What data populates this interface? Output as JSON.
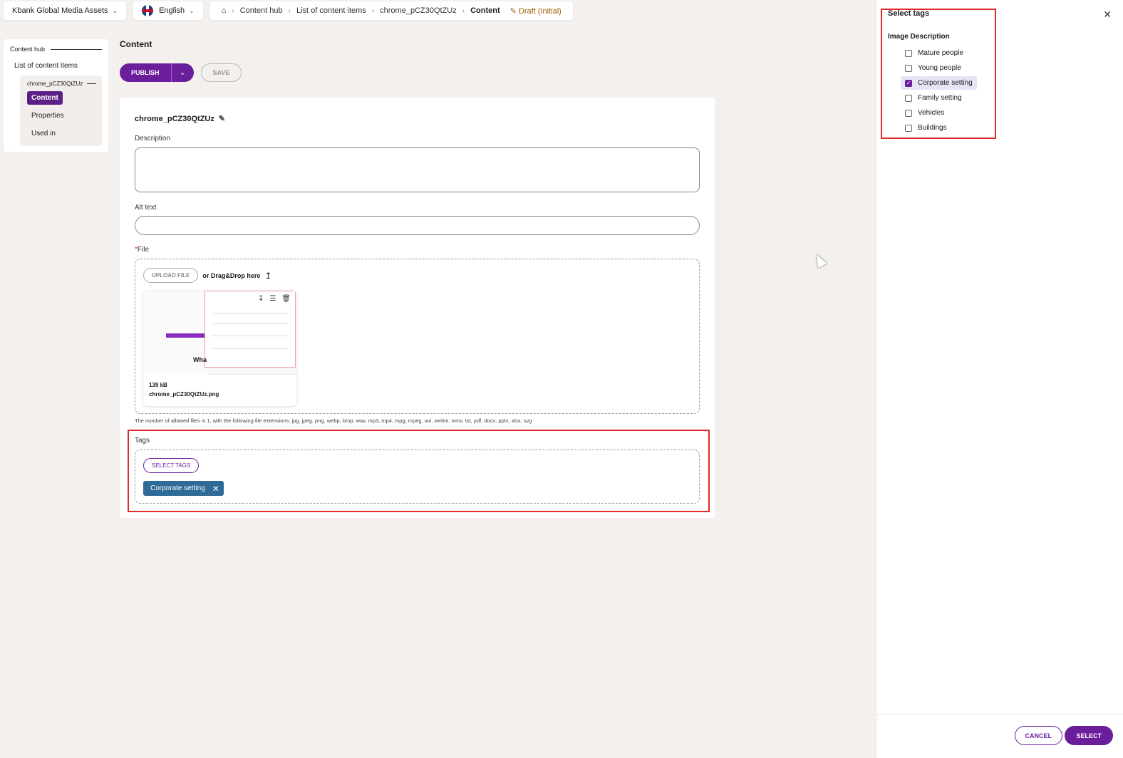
{
  "topbar": {
    "workspace": "Kbank Global Media Assets",
    "language": "English",
    "breadcrumb": [
      "Content hub",
      "List of content items",
      "chrome_pCZ30QtZUz",
      "Content"
    ],
    "status": "Draft (Initial)"
  },
  "leftnav": {
    "hub": "Content hub",
    "list": "List of content items",
    "item": "chrome_pCZ30QtZUz",
    "links": [
      "Content",
      "Properties",
      "Used in"
    ]
  },
  "main": {
    "title": "Content",
    "publish_label": "PUBLISH",
    "save_label": "SAVE",
    "item_name": "chrome_pCZ30QtZUz",
    "description_label": "Description",
    "description_value": "",
    "alt_label": "Alt text",
    "alt_value": "",
    "file_required": "*",
    "file_label": "File",
    "upload_label": "UPLOAD FILE",
    "drag_text": "or Drag&Drop here",
    "file_size": "139 kB",
    "file_name": "chrome_pCZ30QtZUz.png",
    "allowed_text": "The number of allowed files is 1, with the following file extensions: jpg, jpeg, png, webp, bmp, wav, mp3, mp4, mpg, mpeg, avi, webm, wmv, txt, pdf, docx, pptx, xlsx, svg",
    "tags_label": "Tags",
    "select_tags_label": "SELECT TAGS",
    "selected_tag": "Corporate setting",
    "thumb_heading": "Wha"
  },
  "panel": {
    "title": "Select tags",
    "group": "Image Description",
    "options": [
      {
        "label": "Mature people",
        "checked": false
      },
      {
        "label": "Young people",
        "checked": false
      },
      {
        "label": "Corporate setting",
        "checked": true
      },
      {
        "label": "Family setting",
        "checked": false
      },
      {
        "label": "Vehicles",
        "checked": false
      },
      {
        "label": "Buildings",
        "checked": false
      }
    ],
    "cancel_label": "CANCEL",
    "select_label": "SELECT"
  },
  "colors": {
    "primary": "#6a1e9b",
    "chip": "#2e6b96",
    "highlight": "#e02a2a",
    "draft": "#a06000"
  }
}
